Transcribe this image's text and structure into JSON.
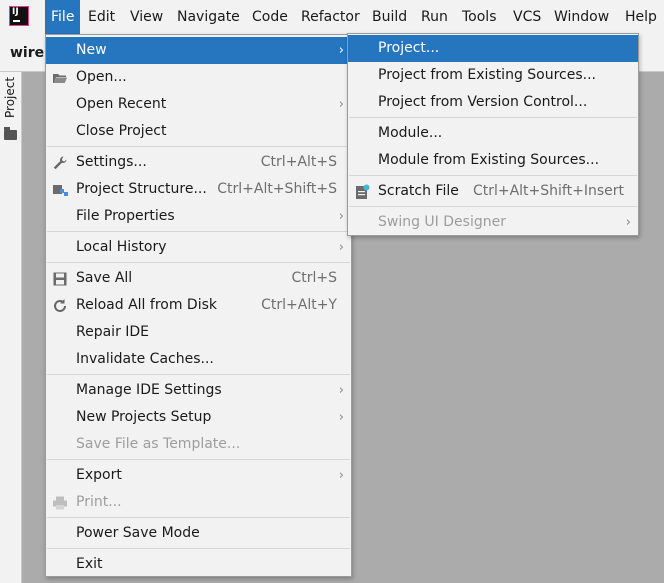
{
  "menubar": {
    "items": [
      "File",
      "Edit",
      "View",
      "Navigate",
      "Code",
      "Refactor",
      "Build",
      "Run",
      "Tools",
      "VCS",
      "Window",
      "Help"
    ]
  },
  "toolbar": {
    "project_name": "wirel"
  },
  "tool_window": {
    "label": "Project"
  },
  "file_menu": {
    "items": [
      {
        "label": "New",
        "shortcut": ""
      },
      {
        "label": "Open...",
        "shortcut": ""
      },
      {
        "label": "Open Recent",
        "shortcut": ""
      },
      {
        "label": "Close Project",
        "shortcut": ""
      },
      {
        "label": "Settings...",
        "shortcut": "Ctrl+Alt+S"
      },
      {
        "label": "Project Structure...",
        "shortcut": "Ctrl+Alt+Shift+S"
      },
      {
        "label": "File Properties",
        "shortcut": ""
      },
      {
        "label": "Local History",
        "shortcut": ""
      },
      {
        "label": "Save All",
        "shortcut": "Ctrl+S"
      },
      {
        "label": "Reload All from Disk",
        "shortcut": "Ctrl+Alt+Y"
      },
      {
        "label": "Repair IDE",
        "shortcut": ""
      },
      {
        "label": "Invalidate Caches...",
        "shortcut": ""
      },
      {
        "label": "Manage IDE Settings",
        "shortcut": ""
      },
      {
        "label": "New Projects Setup",
        "shortcut": ""
      },
      {
        "label": "Save File as Template...",
        "shortcut": ""
      },
      {
        "label": "Export",
        "shortcut": ""
      },
      {
        "label": "Print...",
        "shortcut": ""
      },
      {
        "label": "Power Save Mode",
        "shortcut": ""
      },
      {
        "label": "Exit",
        "shortcut": ""
      }
    ]
  },
  "new_menu": {
    "items": [
      {
        "label": "Project...",
        "shortcut": ""
      },
      {
        "label": "Project from Existing Sources...",
        "shortcut": ""
      },
      {
        "label": "Project from Version Control...",
        "shortcut": ""
      },
      {
        "label": "Module...",
        "shortcut": ""
      },
      {
        "label": "Module from Existing Sources...",
        "shortcut": ""
      },
      {
        "label": "Scratch File",
        "shortcut": "Ctrl+Alt+Shift+Insert"
      },
      {
        "label": "Swing UI Designer",
        "shortcut": ""
      }
    ]
  },
  "colors": {
    "selection": "#2675bf",
    "menu_bg": "#f2f2f2",
    "workspace": "#ababab",
    "disabled": "#9d9d9d"
  }
}
